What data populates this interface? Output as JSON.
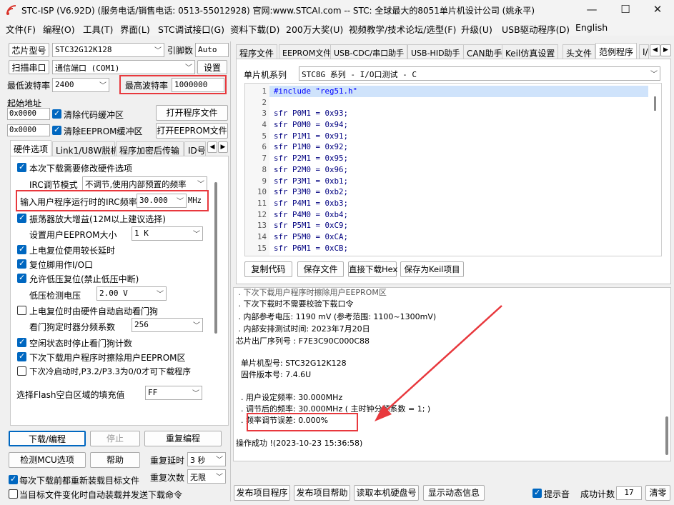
{
  "window": {
    "title": "STC-ISP (V6.92D) (服务电话/销售电话: 0513-55012928) 官网:www.STCAI.com  -- STC: 全球最大的8051单片机设计公司 (姚永平)",
    "minimize": "—",
    "maximize": "☐",
    "close": "✕"
  },
  "menu": [
    "文件(F)",
    "编程(O)",
    "工具(T)",
    "界面(L)",
    "STC调试接口(G)",
    "资料下载(D)",
    "200万大奖(U)",
    "视频教学/技术论坛/选型(F)",
    "升级(U)",
    "USB驱动程序(D)",
    "English"
  ],
  "left": {
    "chip_type_btn": "芯片型号",
    "chip_model": "STC32G12K128",
    "pin_label": "引脚数",
    "pin_value": "Auto",
    "scan_port_btn": "扫描串口",
    "port_value": "通信端口 (COM1)",
    "settings_btn": "设置",
    "min_baud_label": "最低波特率",
    "min_baud_value": "2400",
    "max_baud_label": "最高波特率",
    "max_baud_value": "1000000",
    "start_addr_label": "起始地址",
    "addr1": "0x0000",
    "clear_code_label": "清除代码缓冲区",
    "open_program_btn": "打开程序文件",
    "addr2": "0x0000",
    "clear_eeprom_label": "清除EEPROM缓冲区",
    "open_eeprom_btn": "打开EEPROM文件",
    "tabs": [
      "硬件选项",
      "Link1/U8W脱机",
      "程序加密后传输",
      "ID号"
    ],
    "opt_modify": "本次下载需要修改硬件选项",
    "irc_mode_label": "IRC调节模式",
    "irc_mode_value": "不调节,使用内部预置的频率",
    "irc_freq_label": "输入用户程序运行时的IRC频率",
    "irc_freq_value": "30.000",
    "irc_freq_unit": "MHz",
    "opt_osc": "振荡器放大增益(12M以上建议选择)",
    "eeprom_size_label": "设置用户EEPROM大小",
    "eeprom_size_value": "1    K",
    "opt_long_delay": "上电复位使用较长延时",
    "opt_reset_io": "复位脚用作I/O口",
    "opt_lvr": "允许低压复位(禁止低压中断)",
    "lvd_label": "低压检测电压",
    "lvd_value": "2.00 V",
    "opt_wdt": "上电复位时由硬件自动启动看门狗",
    "wdt_div_label": "看门狗定时器分频系数",
    "wdt_div_value": "256",
    "opt_idle_wdt": "空闲状态时停止看门狗计数",
    "opt_erase_eeprom": "下次下载用户程序时擦除用户EEPROM区",
    "opt_p32": "下次冷启动时,P3.2/P3.3为0/0才可下载程序",
    "flash_fill_label": "选择Flash空白区域的填充值",
    "flash_fill_value": "FF",
    "download_btn": "下载/编程",
    "stop_btn": "停止",
    "reprogram_btn": "重复编程",
    "detect_btn": "检测MCU选项",
    "help_btn": "帮助",
    "repeat_delay_label": "重复延时",
    "repeat_delay_value": "3 秒",
    "repeat_count_label": "重复次数",
    "repeat_count_value": "无限",
    "reload_label": "每次下载前都重新装载目标文件",
    "auto_send_label": "当目标文件变化时自动装载并发送下载命令"
  },
  "right": {
    "tabs": [
      "程序文件",
      "EEPROM文件",
      "USB-CDC/串口助手",
      "USB-HID助手",
      "CAN助手",
      "Keil仿真设置",
      "头文件",
      "范例程序",
      "I/"
    ],
    "series_label": "单片机系列",
    "series_value": "STC8G 系列 - I/O口测试 - C",
    "code_lines": [
      {
        "n": "1",
        "t": "#include \"reg51.h\""
      },
      {
        "n": "2",
        "t": ""
      },
      {
        "n": "3",
        "t": "sfr P0M1 = 0x93;"
      },
      {
        "n": "4",
        "t": "sfr P0M0 = 0x94;"
      },
      {
        "n": "5",
        "t": "sfr P1M1 = 0x91;"
      },
      {
        "n": "6",
        "t": "sfr P1M0 = 0x92;"
      },
      {
        "n": "7",
        "t": "sfr P2M1 = 0x95;"
      },
      {
        "n": "8",
        "t": "sfr P2M0 = 0x96;"
      },
      {
        "n": "9",
        "t": "sfr P3M1 = 0xb1;"
      },
      {
        "n": "10",
        "t": "sfr P3M0 = 0xb2;"
      },
      {
        "n": "11",
        "t": "sfr P4M1 = 0xb3;"
      },
      {
        "n": "12",
        "t": "sfr P4M0 = 0xb4;"
      },
      {
        "n": "13",
        "t": "sfr P5M1 = 0xC9;"
      },
      {
        "n": "14",
        "t": "sfr P5M0 = 0xCA;"
      },
      {
        "n": "15",
        "t": "sfr P6M1 = 0xCB;"
      }
    ],
    "copy_btn": "复制代码",
    "save_btn": "保存文件",
    "direct_dl_btn": "直接下载Hex",
    "save_keil_btn": "保存为Keil项目",
    "log": {
      "l0": " . 下次下载用户程序时擦除用户EEPROM区",
      "l1": " . 下次下载时不需要校验下载口令",
      "l2": " . 内部参考电压: 1190 mV (参考范围: 1100~1300mV)",
      "l3": " . 内部安排测试时间: 2023年7月20日",
      "l4": "芯片出厂序列号 : F7E3C90C000C88",
      "l6": "  单片机型号: STC32G12K128",
      "l7": "  固件版本号: 7.4.6U",
      "l9": "  . 用户设定频率: 30.000MHz",
      "l10": "  . 调节后的频率: 30.000MHz ( 主时钟分频系数 = 1; )",
      "l11": "  . 频率调节误差: 0.000%",
      "l13": "操作成功 !(2023-10-23 15:36:58)"
    },
    "publish_btn": "发布项目程序",
    "publish_help_btn": "发布项目帮助",
    "read_disk_btn": "读取本机硬盘号",
    "show_dyn_btn": "显示动态信息",
    "beep_label": "提示音",
    "success_count_label": "成功计数",
    "success_count_value": "17",
    "clear_btn": "清零"
  },
  "colors": {
    "accent": "#0067c0",
    "highlight": "#e8383d",
    "code_keyword": "#0000ff"
  }
}
